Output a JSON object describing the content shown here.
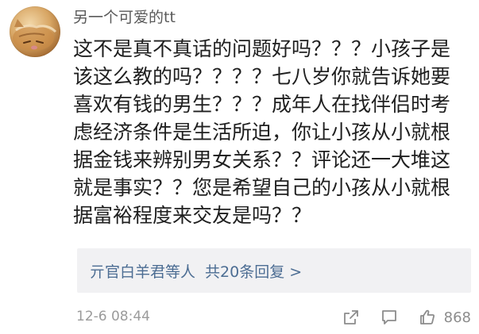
{
  "comment": {
    "username": "另一个可爱的tt",
    "lines": [
      "这不是真不真话的问题好吗？？？小孩子是",
      "该这么教的吗？？？？七八岁你就告诉她要",
      "喜欢有钱的男生？？？成年人在找伴侣时考",
      "虑经济条件是生活所迫，你让小孩从小就根",
      "据金钱来辨别男女关系？？评论还一大堆这",
      "就是事实？？您是希望自己的小孩从小就根",
      "据富裕程度来交友是吗？？"
    ],
    "replies": {
      "names": "亓官白羊君等人",
      "summary": "共20条回复 >"
    },
    "timestamp": "12-6 08:44",
    "like_count": "868"
  },
  "icons": {
    "avatar": "cat-avatar",
    "share": "share-icon",
    "comment": "comment-icon",
    "like": "thumbs-up-icon"
  },
  "colors": {
    "link": "#4c6d93",
    "muted": "#9b9b9b",
    "reply_bg": "#f1f1f3"
  }
}
